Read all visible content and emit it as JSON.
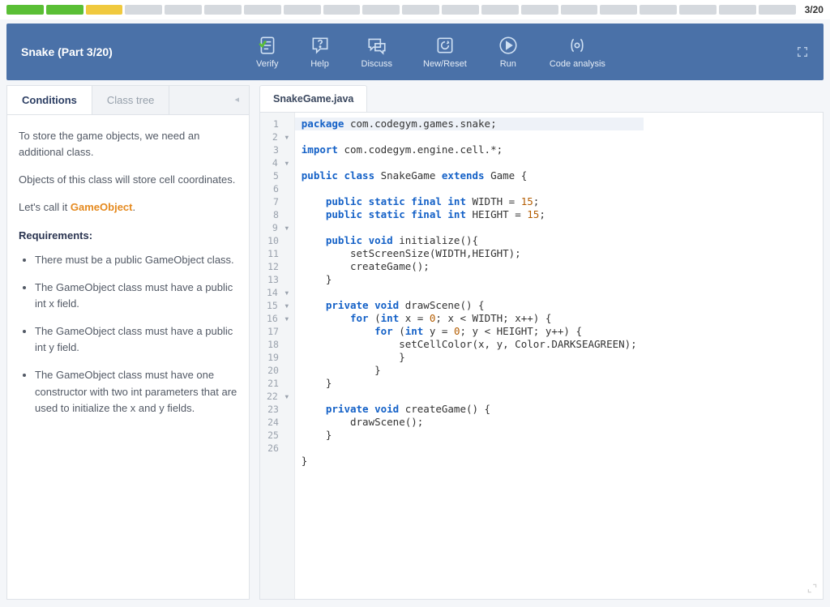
{
  "progress": {
    "segments": [
      "green",
      "green",
      "yellow",
      "gray",
      "gray",
      "gray",
      "gray",
      "gray",
      "gray",
      "gray",
      "gray",
      "gray",
      "gray",
      "gray",
      "gray",
      "gray",
      "gray",
      "gray",
      "gray",
      "gray"
    ],
    "label": "3/20"
  },
  "header": {
    "title": "Snake (Part 3/20)"
  },
  "toolbar": {
    "verify": "Verify",
    "help": "Help",
    "discuss": "Discuss",
    "newreset": "New/Reset",
    "run": "Run",
    "analysis": "Code analysis"
  },
  "left": {
    "tab_conditions": "Conditions",
    "tab_classtree": "Class tree",
    "intro1": "To store the game objects, we need an additional class.",
    "intro2": "Objects of this class will store cell coordinates.",
    "intro3_pre": "Let's call it ",
    "intro3_hl": "GameObject",
    "intro3_post": ".",
    "req_title": "Requirements:",
    "reqs": [
      "There must be a public GameObject class.",
      "The GameObject class must have a public int x field.",
      "The GameObject class must have a public int y field.",
      "The GameObject class must have one constructor with two int parameters that are used to initialize the x and y fields."
    ]
  },
  "file": {
    "tab": "SnakeGame.java"
  },
  "code": {
    "l1_a": "package",
    "l1_b": " com.codegym.games.snake;",
    "l2_a": "import",
    "l2_b": " com.codegym.engine.cell.*;",
    "l4_a": "public class",
    "l4_b": " SnakeGame ",
    "l4_c": "extends",
    "l4_d": " Game {",
    "l6_a": "    public static final int",
    "l6_b": " WIDTH = ",
    "l6_n": "15",
    "l6_c": ";",
    "l7_a": "    public static final int",
    "l7_b": " HEIGHT = ",
    "l7_n": "15",
    "l7_c": ";",
    "l9_a": "    public void",
    "l9_b": " initialize(){",
    "l10": "        setScreenSize(WIDTH,HEIGHT);",
    "l11": "        createGame();",
    "l12": "    }",
    "l14_a": "    private void",
    "l14_b": " drawScene() {",
    "l15_a": "        for",
    "l15_b": " (",
    "l15_c": "int",
    "l15_d": " x = ",
    "l15_n": "0",
    "l15_e": "; x < WIDTH; x++) {",
    "l16_a": "            for",
    "l16_b": " (",
    "l16_c": "int",
    "l16_d": " y = ",
    "l16_n": "0",
    "l16_e": "; y < HEIGHT; y++) {",
    "l17": "                setCellColor(x, y, Color.DARKSEAGREEN);",
    "l18": "                }",
    "l19": "            }",
    "l20": "    }",
    "l22_a": "    private void",
    "l22_b": " createGame() {",
    "l23": "        drawScene();",
    "l24": "    }",
    "l26": "}"
  }
}
